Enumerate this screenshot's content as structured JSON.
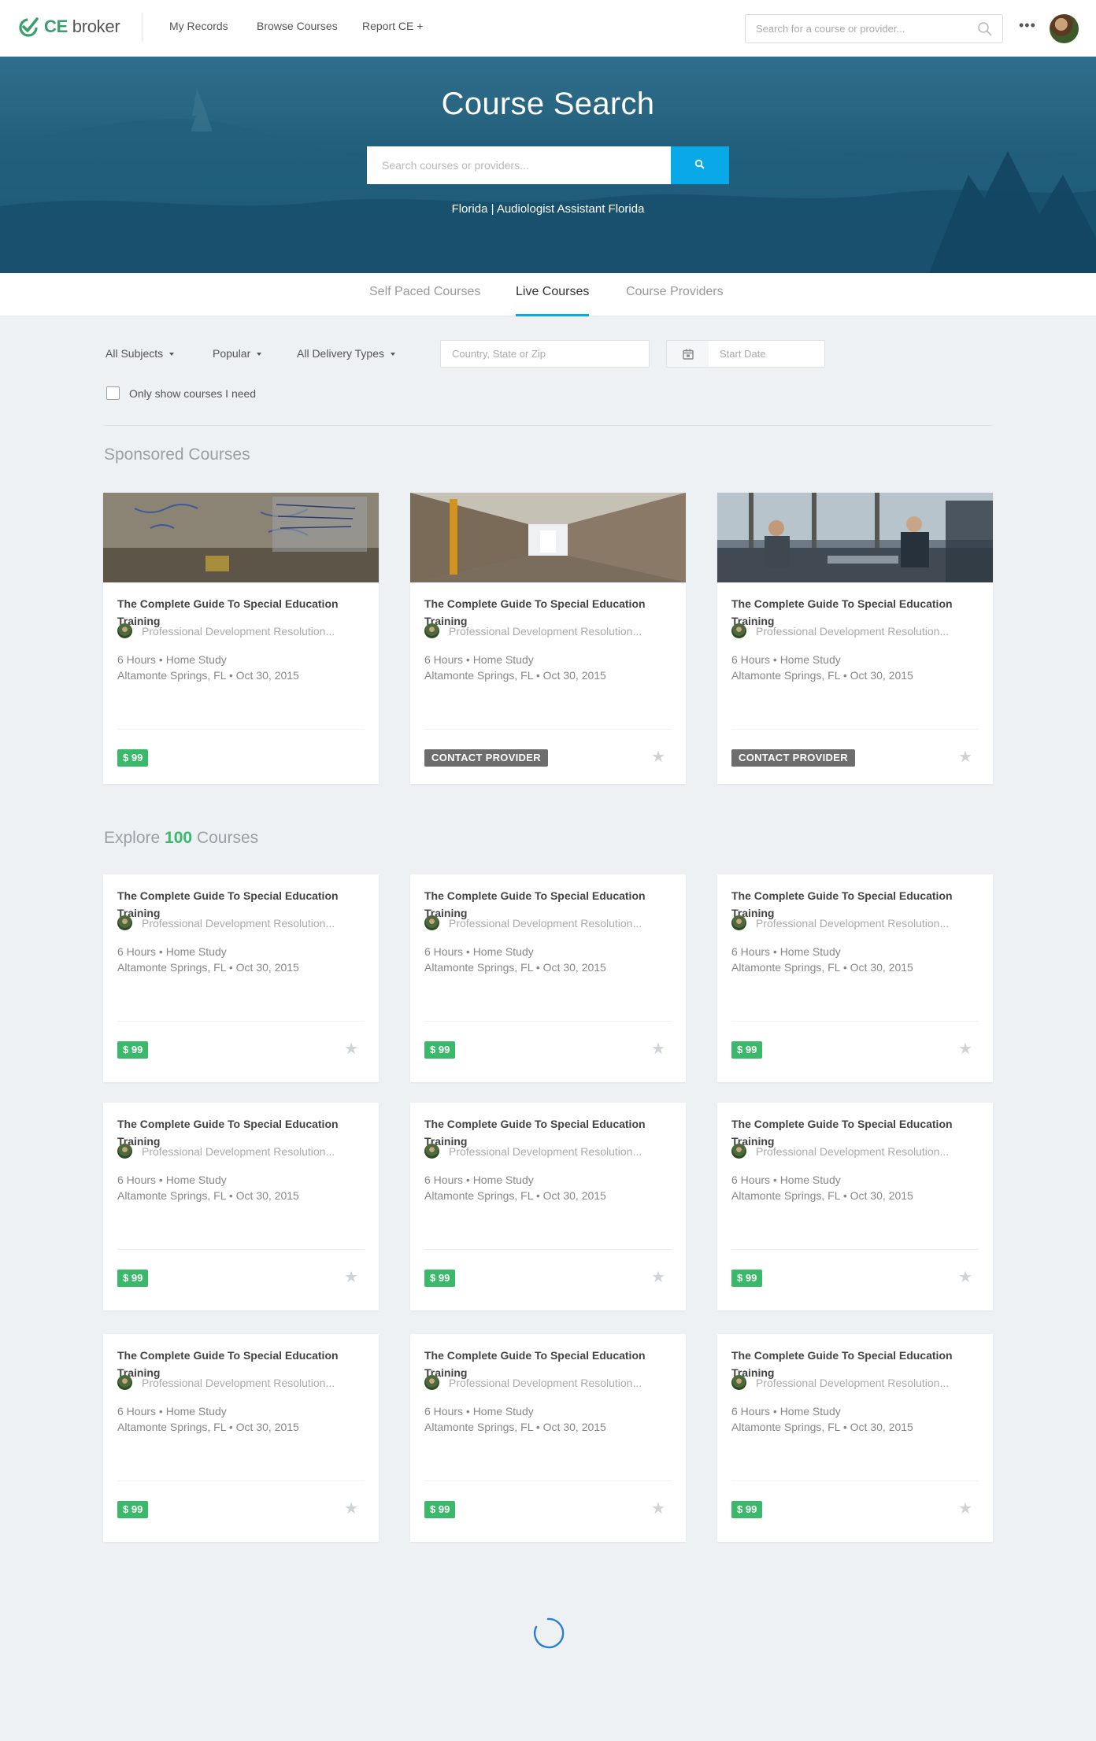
{
  "nav": {
    "brand_ce": "CE",
    "brand_broker": "broker",
    "links": [
      "My Records",
      "Browse Courses",
      "Report CE +"
    ],
    "search_placeholder": "Search for a course or provider...",
    "more": "•••"
  },
  "hero": {
    "title": "Course Search",
    "search_placeholder": "Search courses or providers...",
    "location": "Florida | Audiologist Assistant Florida"
  },
  "tabs": [
    {
      "label": "Self Paced Courses",
      "active": false
    },
    {
      "label": "Live Courses",
      "active": true
    },
    {
      "label": "Course Providers",
      "active": false
    }
  ],
  "filters": {
    "subjects": "All Subjects",
    "sort": "Popular",
    "delivery": "All Delivery Types",
    "location_placeholder": "Country, State or Zip",
    "date_placeholder": "Start Date",
    "only_needed": "Only show courses I need"
  },
  "sponsored": {
    "title": "Sponsored Courses",
    "cards": [
      {
        "title": "The Complete Guide To Special Education Training",
        "provider": "Professional Development Resolution...",
        "meta1": "6 Hours • Home Study",
        "meta2": "Altamonte Springs, FL • Oct 30, 2015",
        "action": "$ 99",
        "type": "price",
        "star": false
      },
      {
        "title": "The Complete Guide To Special Education Training",
        "provider": "Professional Development Resolution...",
        "meta1": "6 Hours • Home Study",
        "meta2": "Altamonte Springs, FL • Oct 30, 2015",
        "action": "CONTACT PROVIDER",
        "type": "contact",
        "star": true
      },
      {
        "title": "The Complete Guide To Special Education Training",
        "provider": "Professional Development Resolution...",
        "meta1": "6 Hours • Home Study",
        "meta2": "Altamonte Springs, FL • Oct 30, 2015",
        "action": "CONTACT PROVIDER",
        "type": "contact",
        "star": true
      }
    ]
  },
  "explore": {
    "prefix": "Explore",
    "count": "100",
    "suffix": "Courses",
    "cards": [
      {
        "title": "The Complete Guide To Special Education Training",
        "provider": "Professional Development Resolution...",
        "meta1": "6 Hours • Home Study",
        "meta2": "Altamonte Springs, FL • Oct 30, 2015",
        "price": "$ 99"
      },
      {
        "title": "The Complete Guide To Special Education Training",
        "provider": "Professional Development Resolution...",
        "meta1": "6 Hours • Home Study",
        "meta2": "Altamonte Springs, FL • Oct 30, 2015",
        "price": "$ 99"
      },
      {
        "title": "The Complete Guide To Special Education Training",
        "provider": "Professional Development Resolution...",
        "meta1": "6 Hours • Home Study",
        "meta2": "Altamonte Springs, FL • Oct 30, 2015",
        "price": "$ 99"
      },
      {
        "title": "The Complete Guide To Special Education Training",
        "provider": "Professional Development Resolution...",
        "meta1": "6 Hours • Home Study",
        "meta2": "Altamonte Springs, FL • Oct 30, 2015",
        "price": "$ 99"
      },
      {
        "title": "The Complete Guide To Special Education Training",
        "provider": "Professional Development Resolution...",
        "meta1": "6 Hours • Home Study",
        "meta2": "Altamonte Springs, FL • Oct 30, 2015",
        "price": "$ 99"
      },
      {
        "title": "The Complete Guide To Special Education Training",
        "provider": "Professional Development Resolution...",
        "meta1": "6 Hours • Home Study",
        "meta2": "Altamonte Springs, FL • Oct 30, 2015",
        "price": "$ 99"
      },
      {
        "title": "The Complete Guide To Special Education Training",
        "provider": "Professional Development Resolution...",
        "meta1": "6 Hours • Home Study",
        "meta2": "Altamonte Springs, FL • Oct 30, 2015",
        "price": "$ 99"
      },
      {
        "title": "The Complete Guide To Special Education Training",
        "provider": "Professional Development Resolution...",
        "meta1": "6 Hours • Home Study",
        "meta2": "Altamonte Springs, FL • Oct 30, 2015",
        "price": "$ 99"
      },
      {
        "title": "The Complete Guide To Special Education Training",
        "provider": "Professional Development Resolution...",
        "meta1": "6 Hours • Home Study",
        "meta2": "Altamonte Springs, FL • Oct 30, 2015",
        "price": "$ 99"
      }
    ]
  },
  "colors": {
    "accent": "#09a9e8",
    "price": "#3bb96a",
    "contact": "#6d6d6d"
  }
}
